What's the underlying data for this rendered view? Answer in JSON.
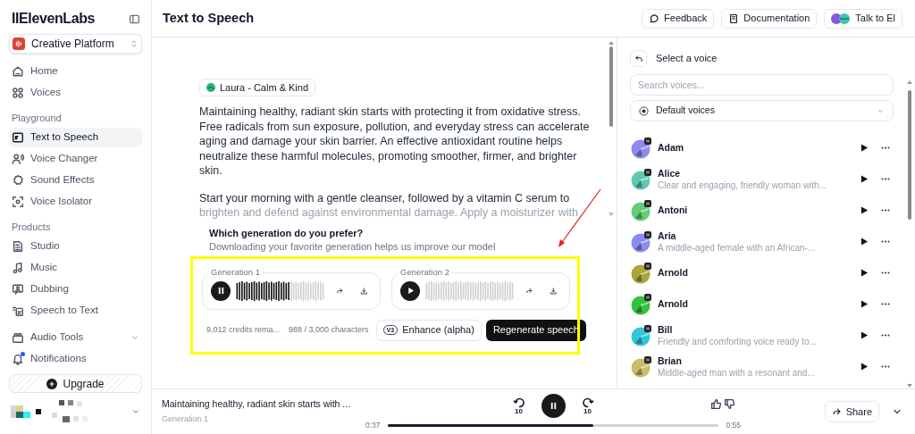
{
  "sidebar": {
    "logo": "IIElevenLabs",
    "workspace": "Creative Platform",
    "sections": [
      {
        "items": [
          {
            "label": "Home",
            "selected": false
          },
          {
            "label": "Voices",
            "selected": false
          }
        ]
      },
      {
        "heading": "Playground",
        "items": [
          {
            "label": "Text to Speech",
            "selected": true
          },
          {
            "label": "Voice Changer",
            "selected": false
          },
          {
            "label": "Sound Effects",
            "selected": false
          },
          {
            "label": "Voice Isolator",
            "selected": false
          }
        ]
      },
      {
        "heading": "Products",
        "items": [
          {
            "label": "Studio",
            "selected": false
          },
          {
            "label": "Music",
            "selected": false
          },
          {
            "label": "Dubbing",
            "selected": false
          },
          {
            "label": "Speech to Text",
            "selected": false
          }
        ]
      },
      {
        "items": [
          {
            "label": "Audio Tools",
            "selected": false,
            "expanded": false
          },
          {
            "label": "Notifications",
            "selected": false,
            "unread": true
          }
        ]
      }
    ],
    "upgrade": "Upgrade"
  },
  "header": {
    "title": "Text to Speech",
    "buttons": [
      "Feedback",
      "Documentation",
      "Talk to El"
    ]
  },
  "editor": {
    "voice": "Laura - Calm & Kind",
    "paragraphs": [
      "Maintaining healthy, radiant skin starts with protecting it from oxidative stress. Free radicals from sun exposure, pollution, and everyday stress can accelerate aging and damage your skin barrier. An effective antioxidant routine helps neutralize these harmful molecules, promoting smoother, firmer, and brighter skin.",
      "Start your morning with a gentle cleanser, followed by a vitamin C serum to"
    ],
    "faded_line": "brighten and defend against environmental damage. Apply a moisturizer with"
  },
  "feedback": {
    "question": "Which generation do you prefer?",
    "hint": "Downloading your favorite generation helps us improve our model",
    "generations": [
      {
        "label": "Generation 1",
        "playing": true
      },
      {
        "label": "Generation 2",
        "playing": false
      }
    ],
    "credits": "9,012 credits rema...",
    "characters": "988 / 3,000 characters",
    "enhance_badge": "V3",
    "enhance": "Enhance (alpha)",
    "regenerate": "Regenerate speech"
  },
  "voice_panel": {
    "title": "Select a voice",
    "search_placeholder": "Search voices...",
    "filter": "Default voices",
    "voices": [
      {
        "name": "Adam",
        "color": "#8b8cf0"
      },
      {
        "name": "Alice",
        "description": "Clear and engaging, friendly woman with...",
        "color": "#5fc9b0"
      },
      {
        "name": "Antoni",
        "color": "#5fcf7a"
      },
      {
        "name": "Aria",
        "description": "A middle-aged female with an African-...",
        "color": "#8b8cf0"
      },
      {
        "name": "Arnold",
        "color": "#a8a83a"
      },
      {
        "name": "Arnold",
        "color": "#33c43f"
      },
      {
        "name": "Bill",
        "description": "Friendly and comforting voice ready to...",
        "color": "#2fc7d6"
      },
      {
        "name": "Brian",
        "description": "Middle-aged man with a resonant and...",
        "color": "#c9bd6a"
      }
    ]
  },
  "player": {
    "title": "Maintaining healthy, radiant skin starts with ...",
    "subtitle": "Generation 1",
    "playing": true,
    "skip_back": "10",
    "skip_forward": "10",
    "elapsed": "0:37",
    "level": 0.62,
    "duration": "0:55",
    "share": "Share"
  }
}
